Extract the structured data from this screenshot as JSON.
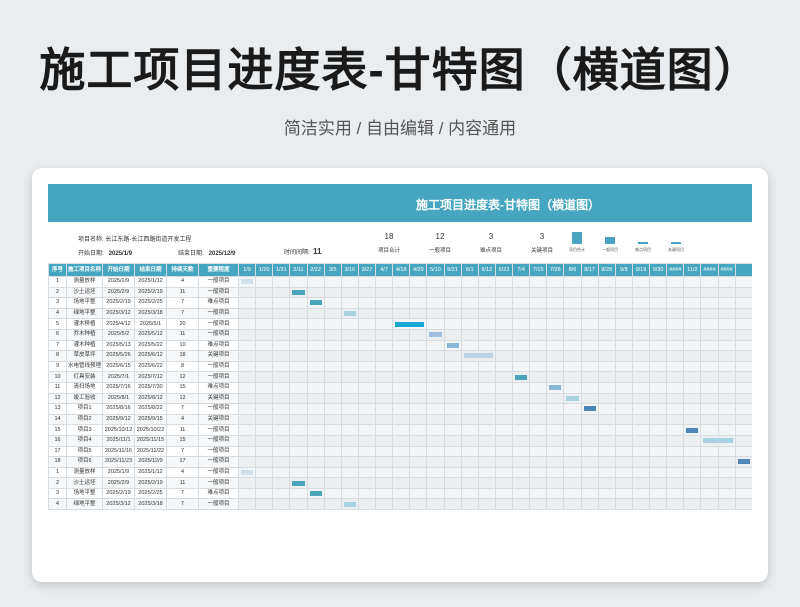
{
  "hero": {
    "title": "施工项目进度表-甘特图（横道图）",
    "subtitle": "简洁实用 / 自由编辑 / 内容通用"
  },
  "sheet": {
    "title": "施工项目进度表-甘特图（横道图）",
    "info": {
      "project_label": "项目名称:",
      "project_value": "长江东路-长江西路街道开发工程",
      "start_label": "开始日期:",
      "start_value": "2025/1/9",
      "end_label": "结束日期:",
      "end_value": "2025/12/9",
      "interval_label": "时间间隔:",
      "interval_value": "11"
    },
    "stats": [
      {
        "value": "18",
        "label": "项目合计"
      },
      {
        "value": "12",
        "label": "一般项目"
      },
      {
        "value": "3",
        "label": "难点项目"
      },
      {
        "value": "3",
        "label": "关键项目"
      }
    ],
    "legend": [
      {
        "label": "项目合计",
        "color": "#4aa3c2"
      },
      {
        "label": "一般项目",
        "color": "#4aa3c2"
      },
      {
        "label": "难点项目",
        "color": "#4aa3c2"
      },
      {
        "label": "关键项目",
        "color": "#4aa3c2"
      }
    ],
    "headers": [
      "序号",
      "施工项目名称",
      "开始日期",
      "结束日期",
      "持续天数",
      "重要程度"
    ],
    "dates": [
      "1/9",
      "1/20",
      "1/31",
      "2/11",
      "2/22",
      "3/5",
      "3/16",
      "3/27",
      "4/7",
      "4/18",
      "4/29",
      "5/10",
      "5/21",
      "6/1",
      "6/12",
      "6/23",
      "7/4",
      "7/15",
      "7/26",
      "8/6",
      "8/17",
      "8/28",
      "9/8",
      "9/19",
      "9/30",
      "####",
      "11/2",
      "####",
      "####"
    ],
    "rows": [
      {
        "no": "1",
        "name": "测量放样",
        "start": "2025/1/9",
        "end": "2025/1/12",
        "days": "4",
        "level": "一般项目",
        "bar": {
          "col": 0,
          "span": 1,
          "color": "#cfe0ea"
        }
      },
      {
        "no": "2",
        "name": "沙土运坯",
        "start": "2025/2/9",
        "end": "2025/2/19",
        "days": "11",
        "level": "一般项目",
        "bar": {
          "col": 3,
          "span": 1,
          "color": "#4aa3b8"
        }
      },
      {
        "no": "3",
        "name": "场地平整",
        "start": "2025/2/19",
        "end": "2025/2/25",
        "days": "7",
        "level": "难点项目",
        "bar": {
          "col": 4,
          "span": 1,
          "color": "#4aa3b8"
        }
      },
      {
        "no": "4",
        "name": "绿地平整",
        "start": "2025/3/12",
        "end": "2025/3/18",
        "days": "7",
        "level": "一般项目",
        "bar": {
          "col": 6,
          "span": 1,
          "color": "#a8d2df"
        }
      },
      {
        "no": "5",
        "name": "灌木移植",
        "start": "2025/4/12",
        "end": "2025/5/1",
        "days": "20",
        "level": "一般项目",
        "bar": {
          "col": 9,
          "span": 2,
          "color": "#1ba7d6"
        }
      },
      {
        "no": "6",
        "name": "乔木种植",
        "start": "2025/5/2",
        "end": "2025/5/12",
        "days": "11",
        "level": "一般项目",
        "bar": {
          "col": 11,
          "span": 1,
          "color": "#a0bfdc"
        }
      },
      {
        "no": "7",
        "name": "灌木种植",
        "start": "2025/5/13",
        "end": "2025/5/22",
        "days": "10",
        "level": "难点项目",
        "bar": {
          "col": 12,
          "span": 1,
          "color": "#8ab6d8"
        }
      },
      {
        "no": "8",
        "name": "草皮草坪",
        "start": "2025/5/26",
        "end": "2025/6/12",
        "days": "18",
        "level": "关键项目",
        "bar": {
          "col": 13,
          "span": 2,
          "color": "#bcd3e6"
        }
      },
      {
        "no": "9",
        "name": "水电管线预埋",
        "start": "2025/6/15",
        "end": "2025/6/22",
        "days": "8",
        "level": "一般项目",
        "bar": null
      },
      {
        "no": "10",
        "name": "灯具安装",
        "start": "2025/7/1",
        "end": "2025/7/12",
        "days": "12",
        "level": "一般项目",
        "bar": {
          "col": 16,
          "span": 1,
          "color": "#4aa3b8"
        }
      },
      {
        "no": "11",
        "name": "清扫场地",
        "start": "2025/7/16",
        "end": "2025/7/30",
        "days": "15",
        "level": "难点项目",
        "bar": {
          "col": 18,
          "span": 1,
          "color": "#8ab6d8"
        }
      },
      {
        "no": "12",
        "name": "竣工验收",
        "start": "2025/8/1",
        "end": "2025/8/12",
        "days": "12",
        "level": "关键项目",
        "bar": {
          "col": 19,
          "span": 1,
          "color": "#a8d2df"
        }
      },
      {
        "no": "13",
        "name": "项目1",
        "start": "2025/8/16",
        "end": "2025/8/22",
        "days": "7",
        "level": "一般项目",
        "bar": {
          "col": 20,
          "span": 1,
          "color": "#4f86b8"
        }
      },
      {
        "no": "14",
        "name": "项目2",
        "start": "2025/9/12",
        "end": "2025/9/15",
        "days": "4",
        "level": "关键项目",
        "bar": null
      },
      {
        "no": "15",
        "name": "项目3",
        "start": "2025/10/12",
        "end": "2025/10/22",
        "days": "11",
        "level": "一般项目",
        "bar": {
          "col": 26,
          "span": 1,
          "color": "#4f86b8"
        }
      },
      {
        "no": "16",
        "name": "项目4",
        "start": "2025/11/1",
        "end": "2025/11/15",
        "days": "15",
        "level": "一般项目",
        "bar": {
          "col": 27,
          "span": 2,
          "color": "#a8d2df"
        }
      },
      {
        "no": "17",
        "name": "项目5",
        "start": "2025/11/16",
        "end": "2025/11/22",
        "days": "7",
        "level": "一般项目",
        "bar": null
      },
      {
        "no": "18",
        "name": "项目6",
        "start": "2025/11/23",
        "end": "2025/12/9",
        "days": "17",
        "level": "一般项目",
        "bar": {
          "col": 29,
          "span": 1,
          "color": "#4f86b8"
        }
      },
      {
        "no": "1",
        "name": "测量放样",
        "start": "2025/1/9",
        "end": "2025/1/12",
        "days": "4",
        "level": "一般项目",
        "bar": {
          "col": 0,
          "span": 1,
          "color": "#cfe0ea"
        }
      },
      {
        "no": "2",
        "name": "沙土运坯",
        "start": "2025/2/9",
        "end": "2025/2/19",
        "days": "11",
        "level": "一般项目",
        "bar": {
          "col": 3,
          "span": 1,
          "color": "#4aa3b8"
        }
      },
      {
        "no": "3",
        "name": "场地平整",
        "start": "2025/2/19",
        "end": "2025/2/25",
        "days": "7",
        "level": "难点项目",
        "bar": {
          "col": 4,
          "span": 1,
          "color": "#4aa3b8"
        }
      },
      {
        "no": "4",
        "name": "绿地平整",
        "start": "2025/3/12",
        "end": "2025/3/18",
        "days": "7",
        "level": "一般项目",
        "bar": {
          "col": 6,
          "span": 1,
          "color": "#a8d2df"
        }
      }
    ]
  }
}
